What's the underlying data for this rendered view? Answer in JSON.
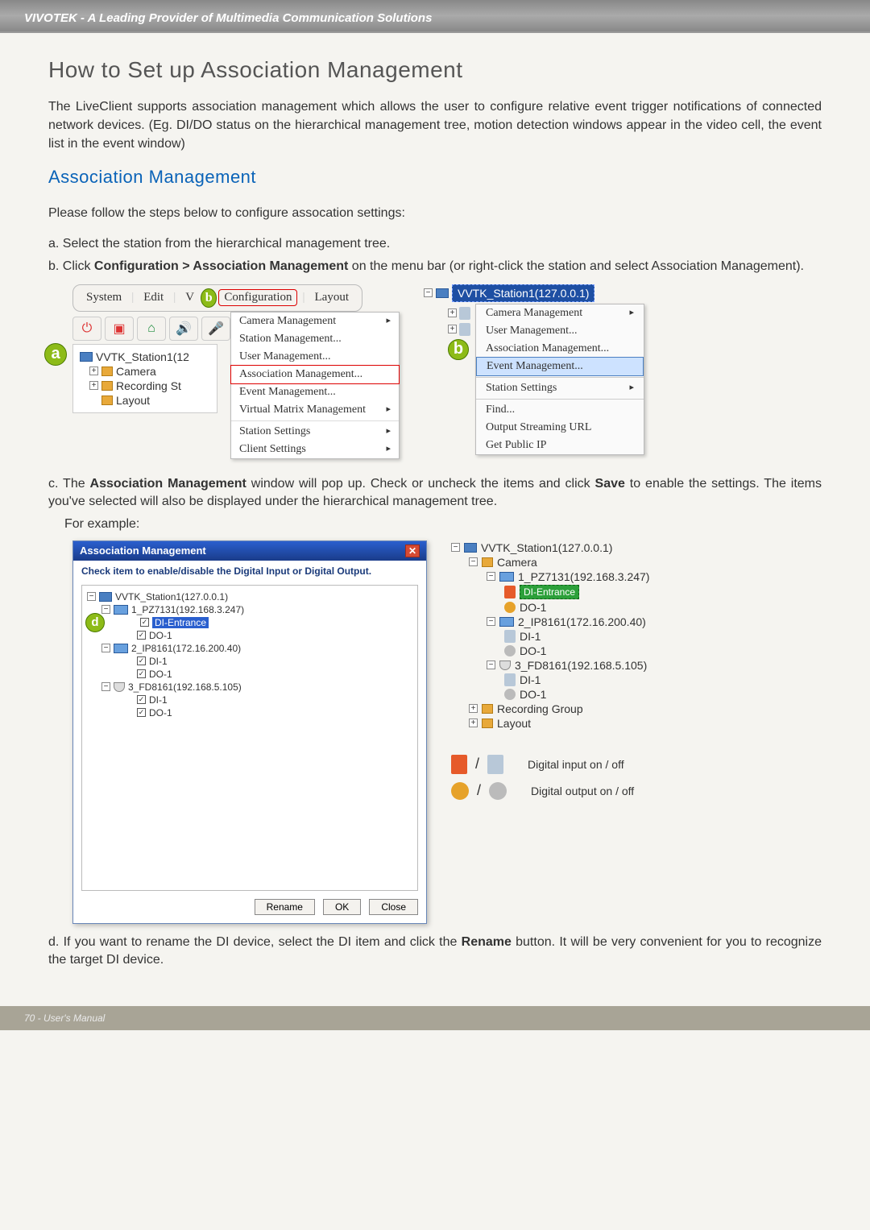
{
  "header": {
    "brand": "VIVOTEK - A Leading Provider of Multimedia Communication Solutions"
  },
  "title": "How to Set up Association Management",
  "intro": "The LiveClient supports association management which allows the user to configure relative event trigger notifications of connected network devices. (Eg. DI/DO status on the hierarchical management tree, motion detection windows appear in the video cell, the event list in the event window)",
  "section_title": "Association Management",
  "lead": "Please follow the steps below to configure assocation settings:",
  "steps": {
    "a": "a. Select the station from the hierarchical management tree.",
    "b_pre": "b. Click ",
    "b_bold": "Configuration > Association Management",
    "b_post": " on the menu bar (or right-click the station and select Association Management).",
    "c_pre": "c. The ",
    "c_bold": "Association Management",
    "c_mid": " window will pop up. Check or uncheck the items and click ",
    "c_bold2": "Save",
    "c_post": " to enable the settings. The items you've selected will also be displayed under the hierarchical management tree.",
    "example": "For example:",
    "d_pre": "d. If you want to rename the DI device, select the DI item and click the ",
    "d_bold": "Rename",
    "d_post": " button. It will be very convenient for you to recognize the target DI device."
  },
  "menubar": {
    "system": "System",
    "edit": "Edit",
    "view_initial": "V",
    "configuration": "Configuration",
    "layout": "Layout"
  },
  "config_menu": {
    "camera": "Camera Management",
    "station": "Station Management...",
    "user": "User Management...",
    "assoc": "Association Management...",
    "event": "Event Management...",
    "virtual": "Virtual Matrix Management",
    "station_settings": "Station Settings",
    "client_settings": "Client Settings"
  },
  "left_tree": {
    "station": "VVTK_Station1(12",
    "camera": "Camera",
    "recording": "Recording St",
    "layout": "Layout"
  },
  "context": {
    "station": "VVTK_Station1(127.0.0.1)",
    "camera": "Camera Management",
    "user": "User Management...",
    "assoc": "Association Management...",
    "event": "Event Management...",
    "station_settings": "Station Settings",
    "find": "Find...",
    "output_url": "Output Streaming URL",
    "get_ip": "Get Public IP"
  },
  "dialog": {
    "title": "Association Management",
    "instr": "Check item to enable/disable the Digital Input or Digital Output.",
    "station": "VVTK_Station1(127.0.0.1)",
    "cam1": "1_PZ7131(192.168.3.247)",
    "di_entrance": "DI-Entrance",
    "do1": "DO-1",
    "cam2": "2_IP8161(172.16.200.40)",
    "di1": "DI-1",
    "cam3": "3_FD8161(192.168.5.105)",
    "btn_rename": "Rename",
    "btn_ok": "OK",
    "btn_close": "Close"
  },
  "result_tree": {
    "station": "VVTK_Station1(127.0.0.1)",
    "camera": "Camera",
    "cam1": "1_PZ7131(192.168.3.247)",
    "di_entrance": "DI-Entrance",
    "do1": "DO-1",
    "cam2": "2_IP8161(172.16.200.40)",
    "di1": "DI-1",
    "cam3": "3_FD8161(192.168.5.105)",
    "recording": "Recording Group",
    "layout": "Layout"
  },
  "legend": {
    "di": "Digital input on / off",
    "do": "Digital output on / off"
  },
  "markers": {
    "a": "a",
    "b": "b",
    "d": "d"
  },
  "footer": "70 - User's Manual"
}
